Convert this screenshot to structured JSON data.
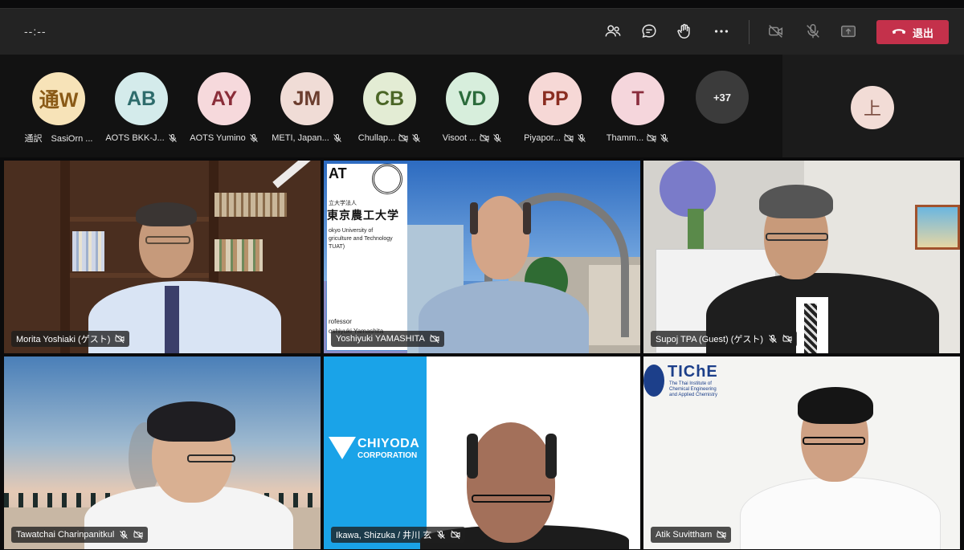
{
  "meeting": {
    "timer": "--:--",
    "leave_label": "退出"
  },
  "toolbar": {
    "icons": [
      "people-icon",
      "chat-icon",
      "raise-hand-icon",
      "more-icon",
      "camera-off-icon",
      "mic-off-icon",
      "share-icon",
      "phone-hangup-icon"
    ]
  },
  "strip": {
    "participants": [
      {
        "initials": "通W",
        "name": "通訳　SasiOrn ...",
        "bg": "#f7e3b8",
        "fg": "#8a5a16",
        "cam": false,
        "mic": false
      },
      {
        "initials": "AB",
        "name": "AOTS BKK-J...",
        "bg": "#d4ebeb",
        "fg": "#2d6b6b",
        "cam": false,
        "mic": true
      },
      {
        "initials": "AY",
        "name": "AOTS Yumino",
        "bg": "#f6d9dc",
        "fg": "#8a2d39",
        "cam": false,
        "mic": true
      },
      {
        "initials": "JM",
        "name": "METI, Japan...",
        "bg": "#f0dcd6",
        "fg": "#6b3d2e",
        "cam": false,
        "mic": true
      },
      {
        "initials": "CB",
        "name": "Chullap...",
        "bg": "#e3ecd4",
        "fg": "#4b6626",
        "cam": true,
        "mic": true
      },
      {
        "initials": "VD",
        "name": "Visoot ...",
        "bg": "#d7eedc",
        "fg": "#2b6b3b",
        "cam": true,
        "mic": true
      },
      {
        "initials": "PP",
        "name": "Piyapor...",
        "bg": "#f6d8d6",
        "fg": "#8a2d20",
        "cam": true,
        "mic": true
      },
      {
        "initials": "T",
        "name": "Thamm...",
        "bg": "#f5d6dc",
        "fg": "#8a2d3d",
        "cam": true,
        "mic": true
      }
    ],
    "more_label": "+37",
    "self_initial": "上"
  },
  "tiles": [
    {
      "name": "Morita Yoshiaki (ゲスト)",
      "mic": false
    },
    {
      "name": "Yoshiyuki YAMASHITA",
      "mic": false,
      "slide": {
        "logo": "AT",
        "univ_small": "立大学法人",
        "univ": "東京農工大学",
        "eng1": "okyo University of",
        "eng2": "griculture and Technology",
        "eng3": "TUAT)",
        "role": "rofessor",
        "person": "oshiyuki Yamashita"
      }
    },
    {
      "name": "Supoj TPA (Guest) (ゲスト)",
      "mic": true
    },
    {
      "name": "Tawatchai Charinpanitkul",
      "mic": true
    },
    {
      "name": "Ikawa, Shizuka / 井川 玄",
      "mic": true,
      "logo1": "CHIYODA",
      "logo2": "CORPORATION"
    },
    {
      "name": "Atik Suvittham",
      "mic": false,
      "logo": "TIChE",
      "logo_sub1": "The Thai Institute of",
      "logo_sub2": "Chemical Engineering",
      "logo_sub3": "and Applied Chemistry"
    }
  ]
}
